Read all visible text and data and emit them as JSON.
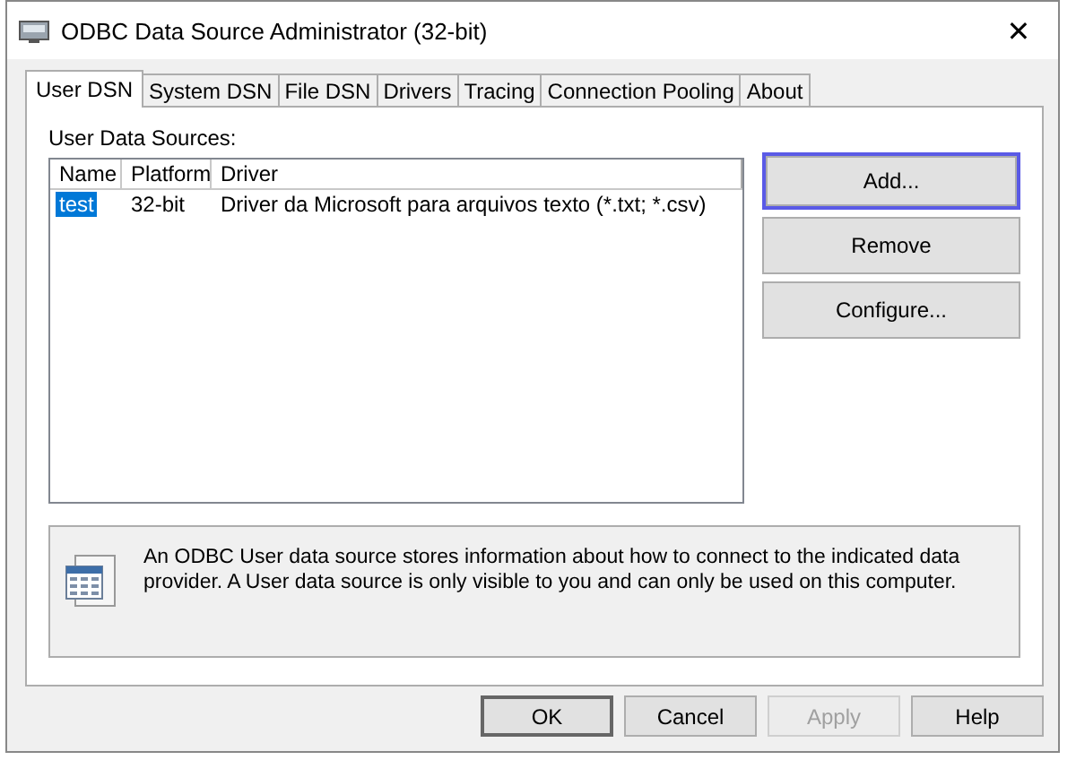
{
  "window": {
    "title": "ODBC Data Source Administrator (32-bit)",
    "close": "✕"
  },
  "tabs": [
    {
      "label": "User DSN",
      "selected": true
    },
    {
      "label": "System DSN",
      "selected": false
    },
    {
      "label": "File DSN",
      "selected": false
    },
    {
      "label": "Drivers",
      "selected": false
    },
    {
      "label": "Tracing",
      "selected": false
    },
    {
      "label": "Connection Pooling",
      "selected": false
    },
    {
      "label": "About",
      "selected": false
    }
  ],
  "group_label": "User Data Sources:",
  "table": {
    "columns": [
      "Name",
      "Platform",
      "Driver"
    ],
    "rows": [
      {
        "cells": [
          "test",
          "32-bit",
          "Driver da Microsoft para arquivos texto (*.txt; *.csv)"
        ],
        "selected": true
      }
    ]
  },
  "side_buttons": [
    {
      "label": "Add...",
      "focused": true
    },
    {
      "label": "Remove",
      "focused": false
    },
    {
      "label": "Configure...",
      "focused": false
    }
  ],
  "info": "An ODBC User data source stores information about how to connect to the indicated data provider.   A User data source is only visible to you and can only be used on this computer.",
  "buttons": [
    {
      "label": "OK",
      "disabled": false,
      "default": true
    },
    {
      "label": "Cancel",
      "disabled": false,
      "default": false
    },
    {
      "label": "Apply",
      "disabled": true,
      "default": false
    },
    {
      "label": "Help",
      "disabled": false,
      "default": false
    }
  ]
}
